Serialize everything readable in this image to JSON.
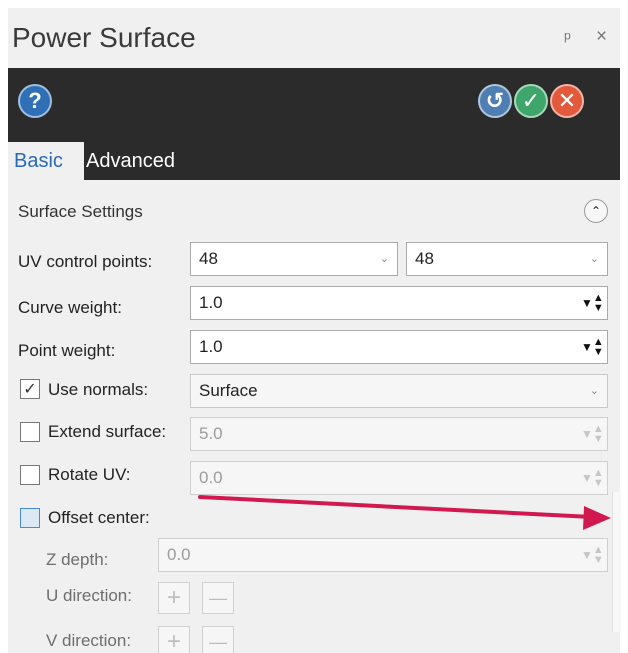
{
  "window": {
    "title": "Power Surface",
    "pin_glyph": "ᵖ",
    "close_glyph": "×"
  },
  "toolbar": {
    "help_glyph": "?",
    "reapply_glyph": "↺",
    "ok_glyph": "✓",
    "cancel_glyph": "✕",
    "help_color": "#2f6fb5",
    "ok_color": "#3ea66b",
    "cancel_color": "#e25a3b"
  },
  "tabs": [
    {
      "label": "Basic",
      "active": true
    },
    {
      "label": "Advanced",
      "active": false
    }
  ],
  "section": {
    "title": "Surface Settings",
    "collapse_glyph": "⌃"
  },
  "form": {
    "uv_control_points": {
      "label": "UV control points:",
      "value_u": "48",
      "value_v": "48"
    },
    "curve_weight": {
      "label": "Curve weight:",
      "value": "1.0"
    },
    "point_weight": {
      "label": "Point weight:",
      "value": "1.0"
    },
    "use_normals": {
      "label": "Use normals:",
      "checked": true,
      "value": "Surface"
    },
    "extend_surface": {
      "label": "Extend surface:",
      "checked": false,
      "value": "5.0"
    },
    "rotate_uv": {
      "label": "Rotate UV:",
      "checked": false,
      "value": "0.0"
    },
    "offset_center": {
      "label": "Offset center:",
      "checked": false
    },
    "z_depth": {
      "label": "Z depth:",
      "value": "0.0"
    },
    "u_direction": {
      "label": "U direction:"
    },
    "v_direction": {
      "label": "V direction:"
    }
  },
  "glyphs": {
    "dropdown": "⌄",
    "spin_up": "▲",
    "spin_down": "▼",
    "check": "✓",
    "plus": "+",
    "minus": "—"
  },
  "annotation": {
    "arrow_color": "#d1194f"
  }
}
